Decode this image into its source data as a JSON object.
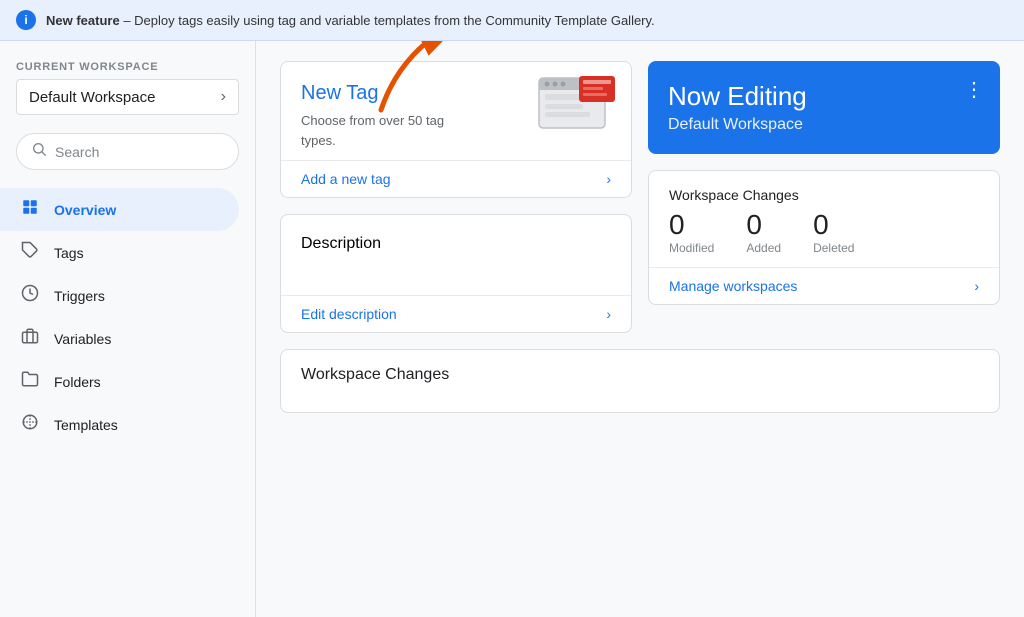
{
  "banner": {
    "icon": "i",
    "text_bold": "New feature",
    "text_rest": " – Deploy tags easily using tag and variable templates from the Community Template Gallery."
  },
  "sidebar": {
    "current_workspace_label": "CURRENT WORKSPACE",
    "workspace_name": "Default Workspace",
    "search_placeholder": "Search",
    "nav_items": [
      {
        "id": "overview",
        "label": "Overview",
        "icon": "⬛",
        "active": true
      },
      {
        "id": "tags",
        "label": "Tags",
        "icon": "🏷",
        "active": false
      },
      {
        "id": "triggers",
        "label": "Triggers",
        "icon": "⚙",
        "active": false
      },
      {
        "id": "variables",
        "label": "Variables",
        "icon": "📷",
        "active": false
      },
      {
        "id": "folders",
        "label": "Folders",
        "icon": "📁",
        "active": false
      },
      {
        "id": "templates",
        "label": "Templates",
        "icon": "◯",
        "active": false
      }
    ]
  },
  "main": {
    "new_tag_card": {
      "title": "New Tag",
      "description": "Choose from over 50 tag types.",
      "action_label": "Add a new tag"
    },
    "description_card": {
      "title": "Description",
      "action_label": "Edit description"
    },
    "now_editing_card": {
      "title": "Now Editing",
      "subtitle": "Default Workspace"
    },
    "workspace_changes_card": {
      "title": "Workspace Changes",
      "stats": [
        {
          "number": "0",
          "label": "Modified"
        },
        {
          "number": "0",
          "label": "Added"
        },
        {
          "number": "0",
          "label": "Deleted"
        }
      ],
      "action_label": "Manage workspaces"
    },
    "workspace_changes_section": {
      "title": "Workspace Changes"
    }
  },
  "colors": {
    "blue": "#1a73e8",
    "orange": "#e65100",
    "light_blue_bg": "#e8f0fe"
  }
}
